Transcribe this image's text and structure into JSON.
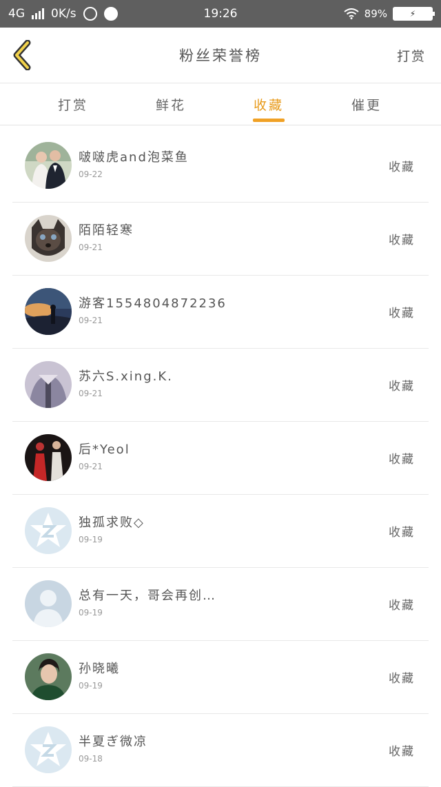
{
  "status": {
    "network": "4G",
    "speed": "0K/s",
    "time": "19:26",
    "battery": "89%"
  },
  "header": {
    "title": "粉丝荣誉榜",
    "action": "打赏"
  },
  "tabs": [
    {
      "label": "打赏"
    },
    {
      "label": "鲜花"
    },
    {
      "label": "收藏"
    },
    {
      "label": "催更"
    }
  ],
  "active_tab": "收藏",
  "accent_color": "#f0a125",
  "rows": [
    {
      "name": "啵啵虎and泡菜鱼",
      "date": "09-22",
      "action": "收藏",
      "avatar": "couple-photo"
    },
    {
      "name": "陌陌轻寒",
      "date": "09-21",
      "action": "收藏",
      "avatar": "cat-photo"
    },
    {
      "name": "游客1554804872236",
      "date": "09-21",
      "action": "收藏",
      "avatar": "sunset-photo"
    },
    {
      "name": "苏六S.xing.K.",
      "date": "09-21",
      "action": "收藏",
      "avatar": "person-photo"
    },
    {
      "name": "后*Yeol",
      "date": "09-21",
      "action": "收藏",
      "avatar": "stage-photo"
    },
    {
      "name": "独孤求败◇",
      "date": "09-19",
      "action": "收藏",
      "avatar": "default-star-avatar"
    },
    {
      "name": "总有一天，哥会再创…",
      "date": "09-19",
      "action": "收藏",
      "avatar": "default-person-avatar"
    },
    {
      "name": "孙晓曦",
      "date": "09-19",
      "action": "收藏",
      "avatar": "boy-photo"
    },
    {
      "name": "半夏ぎ微凉",
      "date": "09-18",
      "action": "收藏",
      "avatar": "default-star-avatar"
    }
  ]
}
